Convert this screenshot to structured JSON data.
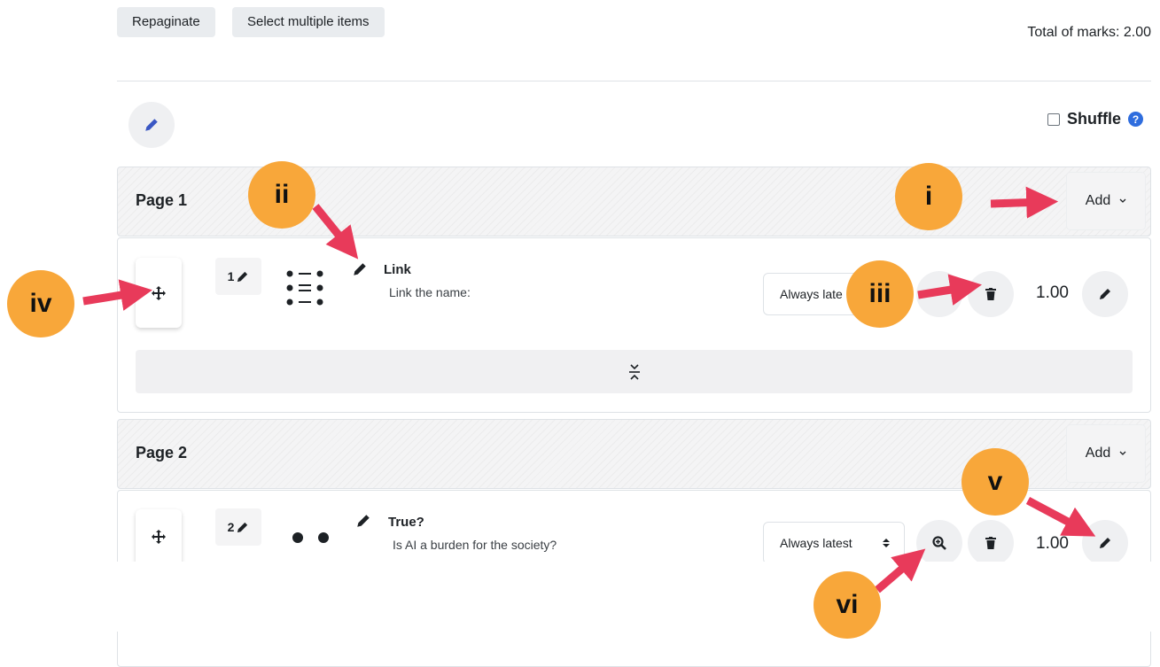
{
  "toolbar": {
    "repaginate_label": "Repaginate",
    "select_multiple_label": "Select multiple items",
    "total_marks": "Total of marks: 2.00"
  },
  "shuffle": {
    "label": "Shuffle",
    "help": "?",
    "checked": false
  },
  "pages": [
    {
      "title": "Page 1",
      "add_label": "Add",
      "slots": [
        {
          "number": "1",
          "name": "Link",
          "text": "Link the name:",
          "version": "Always late",
          "mark": "1.00"
        }
      ]
    },
    {
      "title": "Page 2",
      "add_label": "Add",
      "slots": [
        {
          "number": "2",
          "name": "True?",
          "text": "Is AI a burden for the society?",
          "version": "Always latest",
          "mark": "1.00"
        }
      ]
    }
  ],
  "annotations": [
    "i",
    "ii",
    "iii",
    "iv",
    "v",
    "vi"
  ],
  "colors": {
    "badge": "#f8a73a",
    "arrow": "#e83a5a",
    "help_icon": "#2f6dde",
    "edit_icon": "#3a57c4"
  }
}
